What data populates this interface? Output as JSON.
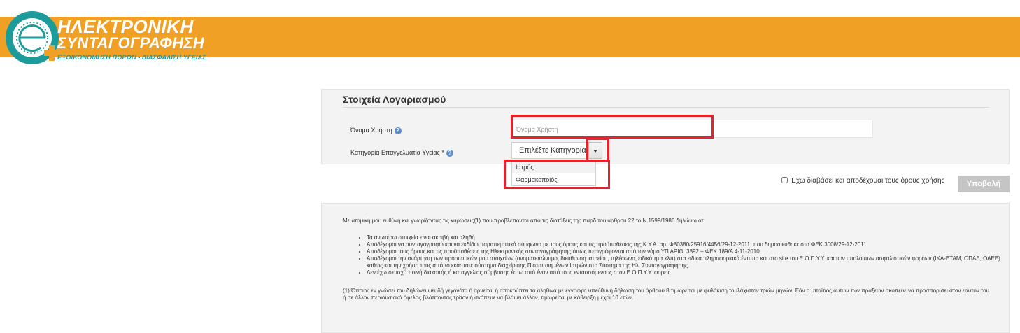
{
  "logo": {
    "line1": "ΗΛΕΚΤΡΟΝΙΚΗ",
    "line2": "ΣΥΝΤΑΓΟΓΡΑΦΗΣΗ",
    "tagline": "ΕΞΟΙΚΟΝΟΜΗΣΗ ΠΟΡΩΝ - ΔΙΑΣΦΑΛΙΣΗ ΥΓΕΙΑΣ",
    "icon": "e-prescription-logo-icon"
  },
  "colors": {
    "banner": "#f0a024",
    "teal": "#1d9b9a",
    "highlight": "#e3232d"
  },
  "form": {
    "title": "Στοιχεία Λογαριασμού",
    "username_label": "Όνομα Χρήστη",
    "username_placeholder": "Όνομα Χρήστη",
    "username_value": "",
    "category_label": "Κατηγορία Επαγγελματία Υγείας *",
    "category_selected": "Επιλέξτε Κατηγορία",
    "category_options": [
      "Ιατρός",
      "Φαρμακοποιός"
    ],
    "help_icon": "question-circle-icon"
  },
  "terms": {
    "label": "Έχω διαβάσει και αποδέχομαι τους όρους χρήσης",
    "checked": false
  },
  "submit_label": "Υποβολή",
  "declaration": {
    "intro": "Με ατομική μου ευθύνη και γνωρίζοντας τις κυρώσεις(1) που προβλέπονται από τις διατάξεις της παρδ του άρθρου 22 το Ν 1599/1986 δηλώνω ότι",
    "items": [
      "Τα ανωτέρω στοιχεία είναι ακριβή και αληθή",
      "Αποδέχομαι να συνταγογραφώ και να εκδίδω παραπεμπτικά σύμφωνα με τους όρους και τις προϋποθέσεις της Κ.Υ.Α. αρ. Φ80380/25916/4456/29-12-2011, που δημοσιεύθηκε στο ΦΕΚ 3008/29-12-2011.",
      "Αποδέχομαι τους όρους και τις προϋποθέσεις της Ηλεκτρονικής συνταγογράφησης όπως περιγράφονται από τον νόμο ΥΠ ΑΡΙΘ. 3892 – ΦΕΚ 189/Α 4-11-2010.",
      "Αποδέχομαι την ανάρτηση των προσωπικών μου στοιχείων (ονοματεπώνυμο, διεύθυνση ιατρείου, τηλέφωνο, ειδικότητα κλπ) στα ειδικά πληροφοριακά έντυπα και στο site του Ε.Ο.Π.Υ.Υ. και των υπολοίπων ασφαλιστικών φορέων (ΙΚΑ-ΕΤΑΜ, ΟΠΑΔ, ΟΑΕΕ) καθώς και την χρήση τους από το εκάστοτε σύστημα διαχείρισης Πιστοποιημένων Ιατρών στο Σύστημα της Ηλ. Συνταγογράφησης.",
      "Δεν έχω σε ισχύ ποινή διακοπής ή καταγγελίας σύμβασης έστω από έναν από τους εντασσόμενους στον Ε.Ο.Π.Υ.Υ. φορείς."
    ],
    "footnote": "(1) Όποιος εν γνώσει του δηλώνει ψευδή γεγονότα ή αρνείται ή αποκρύπτει τα αληθινά με έγγραφη υπεύθυνη δήλωση του άρθρου 8 τιμωρείται με φυλάκιση τουλάχιστον τριών μηνών. Εάν ο υπαίτιος αυτών των πράξεων σκόπευε να προσπορίσει στον εαυτόν του ή σε άλλον περιουσιακό όφελος βλάπτοντας τρίτον ή σκόπευε να βλάψει άλλον, τιμωρείται με κάθειρξη μέχρι 10 ετών."
  }
}
